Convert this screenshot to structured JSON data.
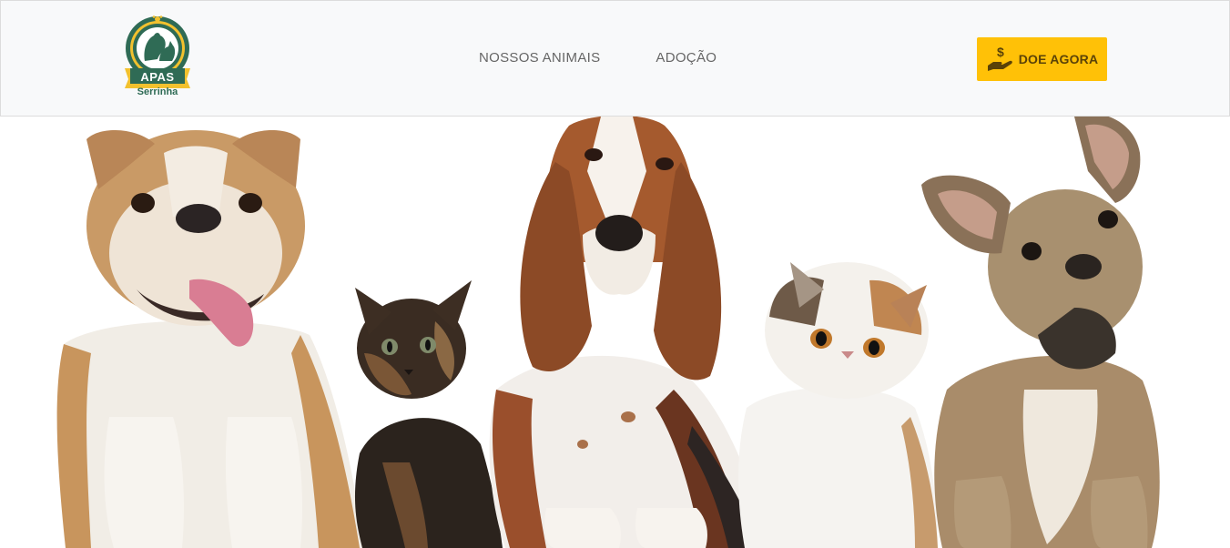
{
  "brand": {
    "name": "APAS",
    "location": "Serrinha",
    "logo_icon": "paw-dog-cat-badge",
    "colors": {
      "badge_green": "#2f6b55",
      "badge_yellow": "#f2c12e"
    }
  },
  "nav": {
    "items": [
      {
        "label": "NOSSOS ANIMAIS"
      },
      {
        "label": "ADOÇÃO"
      }
    ]
  },
  "cta": {
    "label": "DOE AGORA",
    "icon": "hand-dollar-icon",
    "color": "#ffc107"
  },
  "hero": {
    "animals": [
      "english-bulldog",
      "tortoiseshell-kitten",
      "basset-hound",
      "exotic-shorthair-cat",
      "french-bulldog"
    ]
  }
}
